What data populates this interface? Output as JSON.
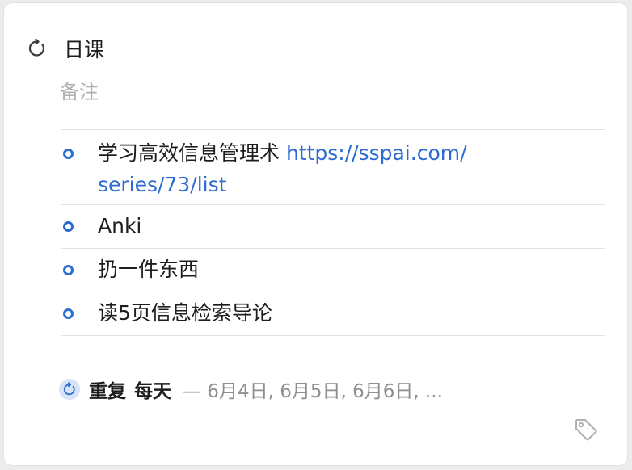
{
  "task": {
    "title": "日课",
    "note_placeholder": "备注"
  },
  "checklist": [
    {
      "text": "学习高效信息管理术 ",
      "link": "https://sspai.com/series/73/list",
      "link_line1": "https://sspai.com/",
      "link_line2": "series/73/list"
    },
    {
      "text": "Anki"
    },
    {
      "text": "扔一件东西"
    },
    {
      "text": "读5页信息检索导论"
    }
  ],
  "repeat": {
    "label": "重复",
    "frequency": "每天",
    "dates": "— 6月4日, 6月5日, 6月6日, ..."
  },
  "colors": {
    "accent": "#2d6bd1",
    "muted": "#8e8e93",
    "placeholder": "#b0b0b4",
    "badge_bg": "#d7e4f8"
  },
  "icons": {
    "title": "repeat-icon",
    "bullet": "checkbox-circle-icon",
    "repeat": "repeat-icon",
    "tags": "tag-icon"
  }
}
